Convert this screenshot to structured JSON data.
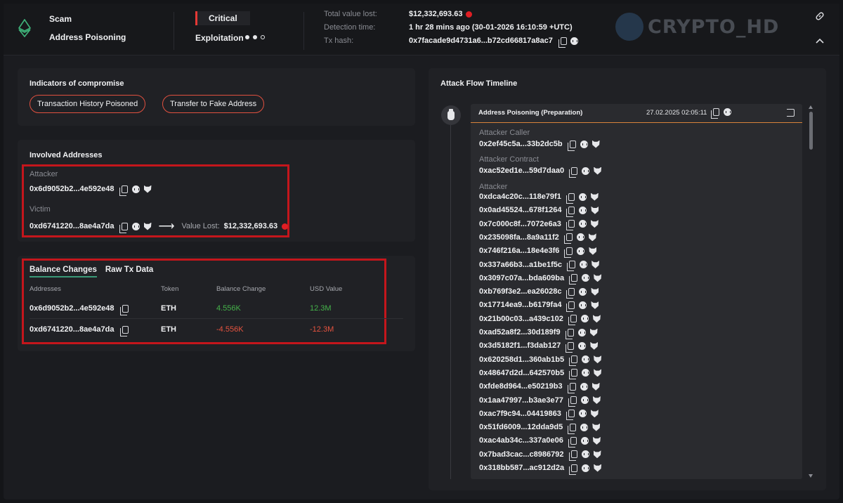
{
  "header": {
    "category": "Scam",
    "subcategory": "Address Poisoning",
    "severity": "Critical",
    "exploitation_label": "Exploitation",
    "exploitation_level": 2,
    "total_value_label": "Total value lost:",
    "total_value": "$12,332,693.63",
    "detection_label": "Detection time:",
    "detection_value": "1 hr 28 mins ago (30-01-2026 16:10:59 +UTC)",
    "tx_label": "Tx hash:",
    "tx_value": "0x7facade9d4731a6...b72cd66817a8ac7",
    "watermark": "CRYPTO_HD"
  },
  "ioc": {
    "title": "Indicators of compromise",
    "tags": [
      "Transaction History Poisoned",
      "Transfer to Fake Address"
    ]
  },
  "involved": {
    "title": "Involved Addresses",
    "attacker_label": "Attacker",
    "attacker_addr": "0x6d9052b2...4e592e48",
    "victim_label": "Victim",
    "victim_addr": "0xd6741220...8ae4a7da",
    "arrow": "⟶",
    "value_lost_label": "Value Lost:",
    "value_lost": "$12,332,693.63"
  },
  "balance": {
    "tabs": [
      "Balance Changes",
      "Raw Tx Data"
    ],
    "columns": [
      "Addresses",
      "Token",
      "Balance Change",
      "USD Value"
    ],
    "rows": [
      {
        "address": "0x6d9052b2...4e592e48",
        "token": "ETH",
        "change": "4.556K",
        "usd": "12.3M"
      },
      {
        "address": "0xd6741220...8ae4a7da",
        "token": "ETH",
        "change": "-4.556K",
        "usd": "-12.3M"
      }
    ]
  },
  "timeline": {
    "title": "Attack Flow Timeline",
    "step_title": "Address Poisoning (Preparation)",
    "step_date": "27.02.2025 02:05:11",
    "caller_label": "Attacker Caller",
    "caller_addr": "0x2ef45c5a...33b2dc5b",
    "contract_label": "Attacker Contract",
    "contract_addr": "0xac52ed1e...59d7daa0",
    "attacker_label": "Attacker",
    "attacker_addrs": [
      "0xdca4c20c...118e79f1",
      "0x0ad45524...678f1264",
      "0x7c000c8f...7072e6a3",
      "0x235098fa...8a9a11f2",
      "0x746f216a...18e4e3f6",
      "0x337a66b3...a1be1f5c",
      "0x3097c07a...bda609ba",
      "0xb769f3e2...ea26028c",
      "0x17714ea9...b6179fa4",
      "0x21b00c03...a439c102",
      "0xad52a8f2...30d189f9",
      "0x3d5182f1...f3dab127",
      "0x620258d1...360ab1b5",
      "0x48647d2d...642570b5",
      "0xfde8d964...e50219b3",
      "0x1aa47997...b3ae3e77",
      "0xac7f9c94...04419863",
      "0x51fd6009...12dda9d5",
      "0xac4ab34c...337a0e06",
      "0x7bad3cac...c8986792",
      "0x318bb587...ac912d2a"
    ]
  }
}
